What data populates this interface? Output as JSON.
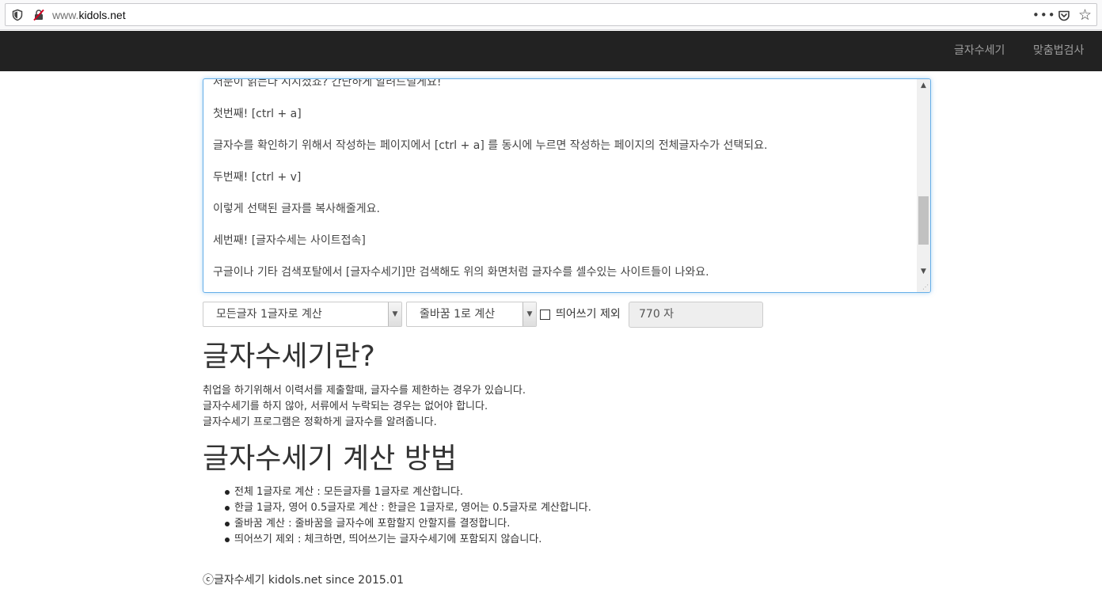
{
  "browser": {
    "url_prefix": "www.",
    "url_domain": "kidols.net",
    "menu_icon": "•••",
    "pocket_icon": "pocket-icon",
    "star_icon": "☆"
  },
  "navbar": {
    "links": [
      "글자수세기",
      "맞춤법검사"
    ]
  },
  "editor": {
    "lines": [
      "저분이 읽는다 시지셨죠? 간단하게 알려드릴게요!",
      "",
      "첫번째! [ctrl + a]",
      "",
      "글자수를 확인하기 위해서 작성하는 페이지에서 [ctrl + a] 를 동시에 누르면 작성하는 페이지의 전체글자수가 선택되요.",
      "",
      "두번째! [ctrl + v]",
      "",
      "이렇게 선택된 글자를 복사해줄게요.",
      "",
      "세번째! [글자수세는 사이트접속]",
      "",
      "구글이나 기타 검색포탈에서 [글자수세기]만 검색해도 위의 화면처럼 글자수를 셀수있는 사이트들이 나와요."
    ]
  },
  "controls": {
    "count_mode": "모든글자 1글자로 계산",
    "newline_mode": "줄바꿈 1로 계산",
    "exclude_space_label": "띄어쓰기 제외",
    "exclude_space_checked": false,
    "count_value": "770 자"
  },
  "intro": {
    "title": "글자수세기란?",
    "lines": [
      "취업을 하기위해서 이력서를 제출할때, 글자수를 제한하는 경우가 있습니다.",
      "글자수세기를 하지 않아, 서류에서 누락되는 경우는 없어야 합니다.",
      "글자수세기 프로그램은 정확하게 글자수를 알려줍니다."
    ]
  },
  "howto": {
    "title": "글자수세기 계산 방법",
    "items": [
      "전체 1글자로 계산 : 모든글자를 1글자로 계산합니다.",
      "한글 1글자, 영어 0.5글자로 계산 : 한글은 1글자로, 영어는 0.5글자로 계산합니다.",
      "줄바꿈 계산 : 줄바꿈을 글자수에 포함할지 안할지를 결정합니다.",
      "띄어쓰기 제외 : 체크하면, 띄어쓰기는 글자수세기에 포함되지 않습니다."
    ]
  },
  "footer": {
    "text": "ⓒ글자수세기 kidols.net since 2015.01"
  }
}
